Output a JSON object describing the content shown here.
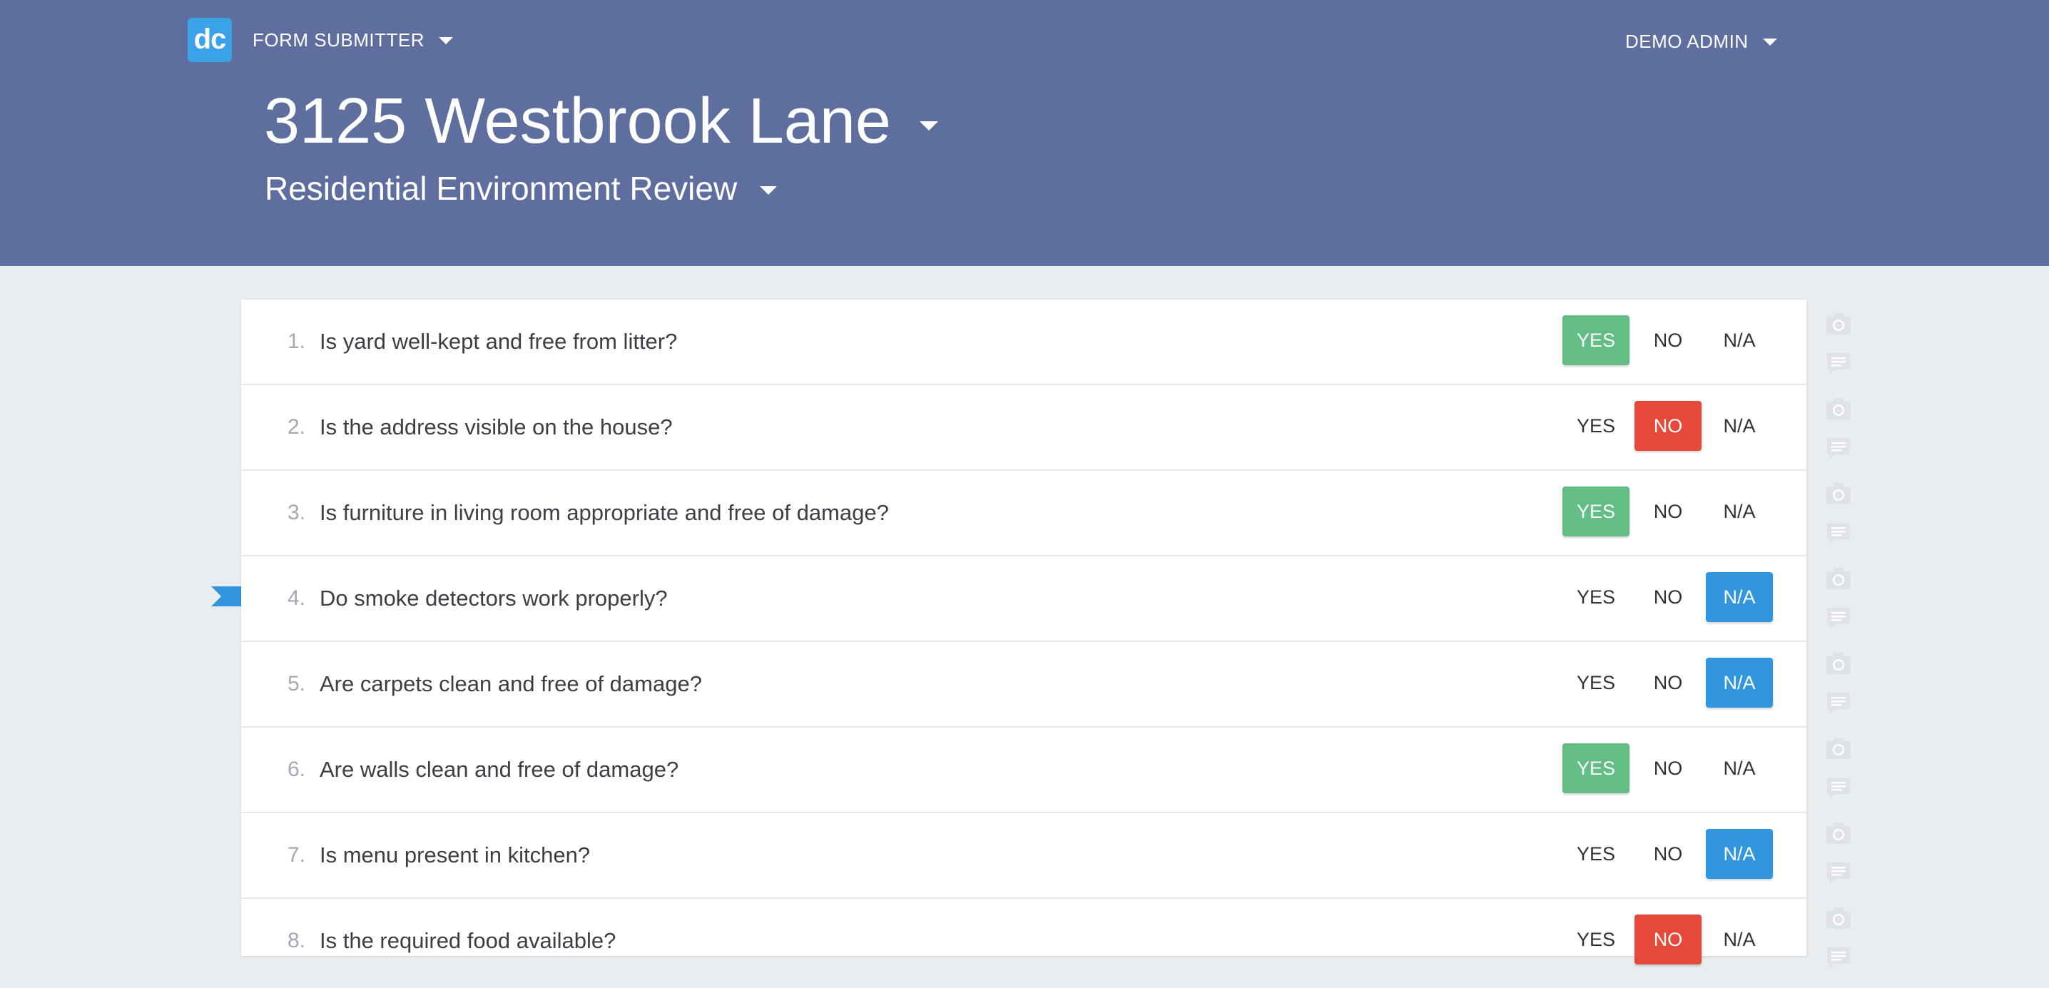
{
  "app": {
    "logo_text": "dc",
    "menu_label": "FORM SUBMITTER",
    "user_label": "DEMO ADMIN"
  },
  "page": {
    "title": "3125 Westbrook Lane",
    "subtitle": "Residential Environment Review"
  },
  "options": {
    "yes": "YES",
    "no": "NO",
    "na": "N/A"
  },
  "questions": [
    {
      "num": "1.",
      "text": "Is yard well-kept and free from litter?",
      "answer": "yes"
    },
    {
      "num": "2.",
      "text": "Is the address visible on the house?",
      "answer": "no"
    },
    {
      "num": "3.",
      "text": "Is furniture in living room appropriate and free of damage?",
      "answer": "yes"
    },
    {
      "num": "4.",
      "text": "Do smoke detectors work properly?",
      "answer": "na"
    },
    {
      "num": "5.",
      "text": "Are carpets clean and free of damage?",
      "answer": "na"
    },
    {
      "num": "6.",
      "text": "Are walls clean and free of damage?",
      "answer": "yes"
    },
    {
      "num": "7.",
      "text": "Is menu present in kitchen?",
      "answer": "na"
    },
    {
      "num": "8.",
      "text": "Is the required food available?",
      "answer": "no"
    }
  ],
  "current_question": 4,
  "colors": {
    "header_bg": "#5e6e9f",
    "logo_bg": "#3aa2e6",
    "yes_selected": "#63be85",
    "no_selected": "#e6493a",
    "na_selected": "#3196dd",
    "page_bg": "#e9edf0"
  },
  "icons": [
    "chevron-down-icon",
    "camera-icon",
    "comment-icon",
    "current-question-flag-icon"
  ]
}
